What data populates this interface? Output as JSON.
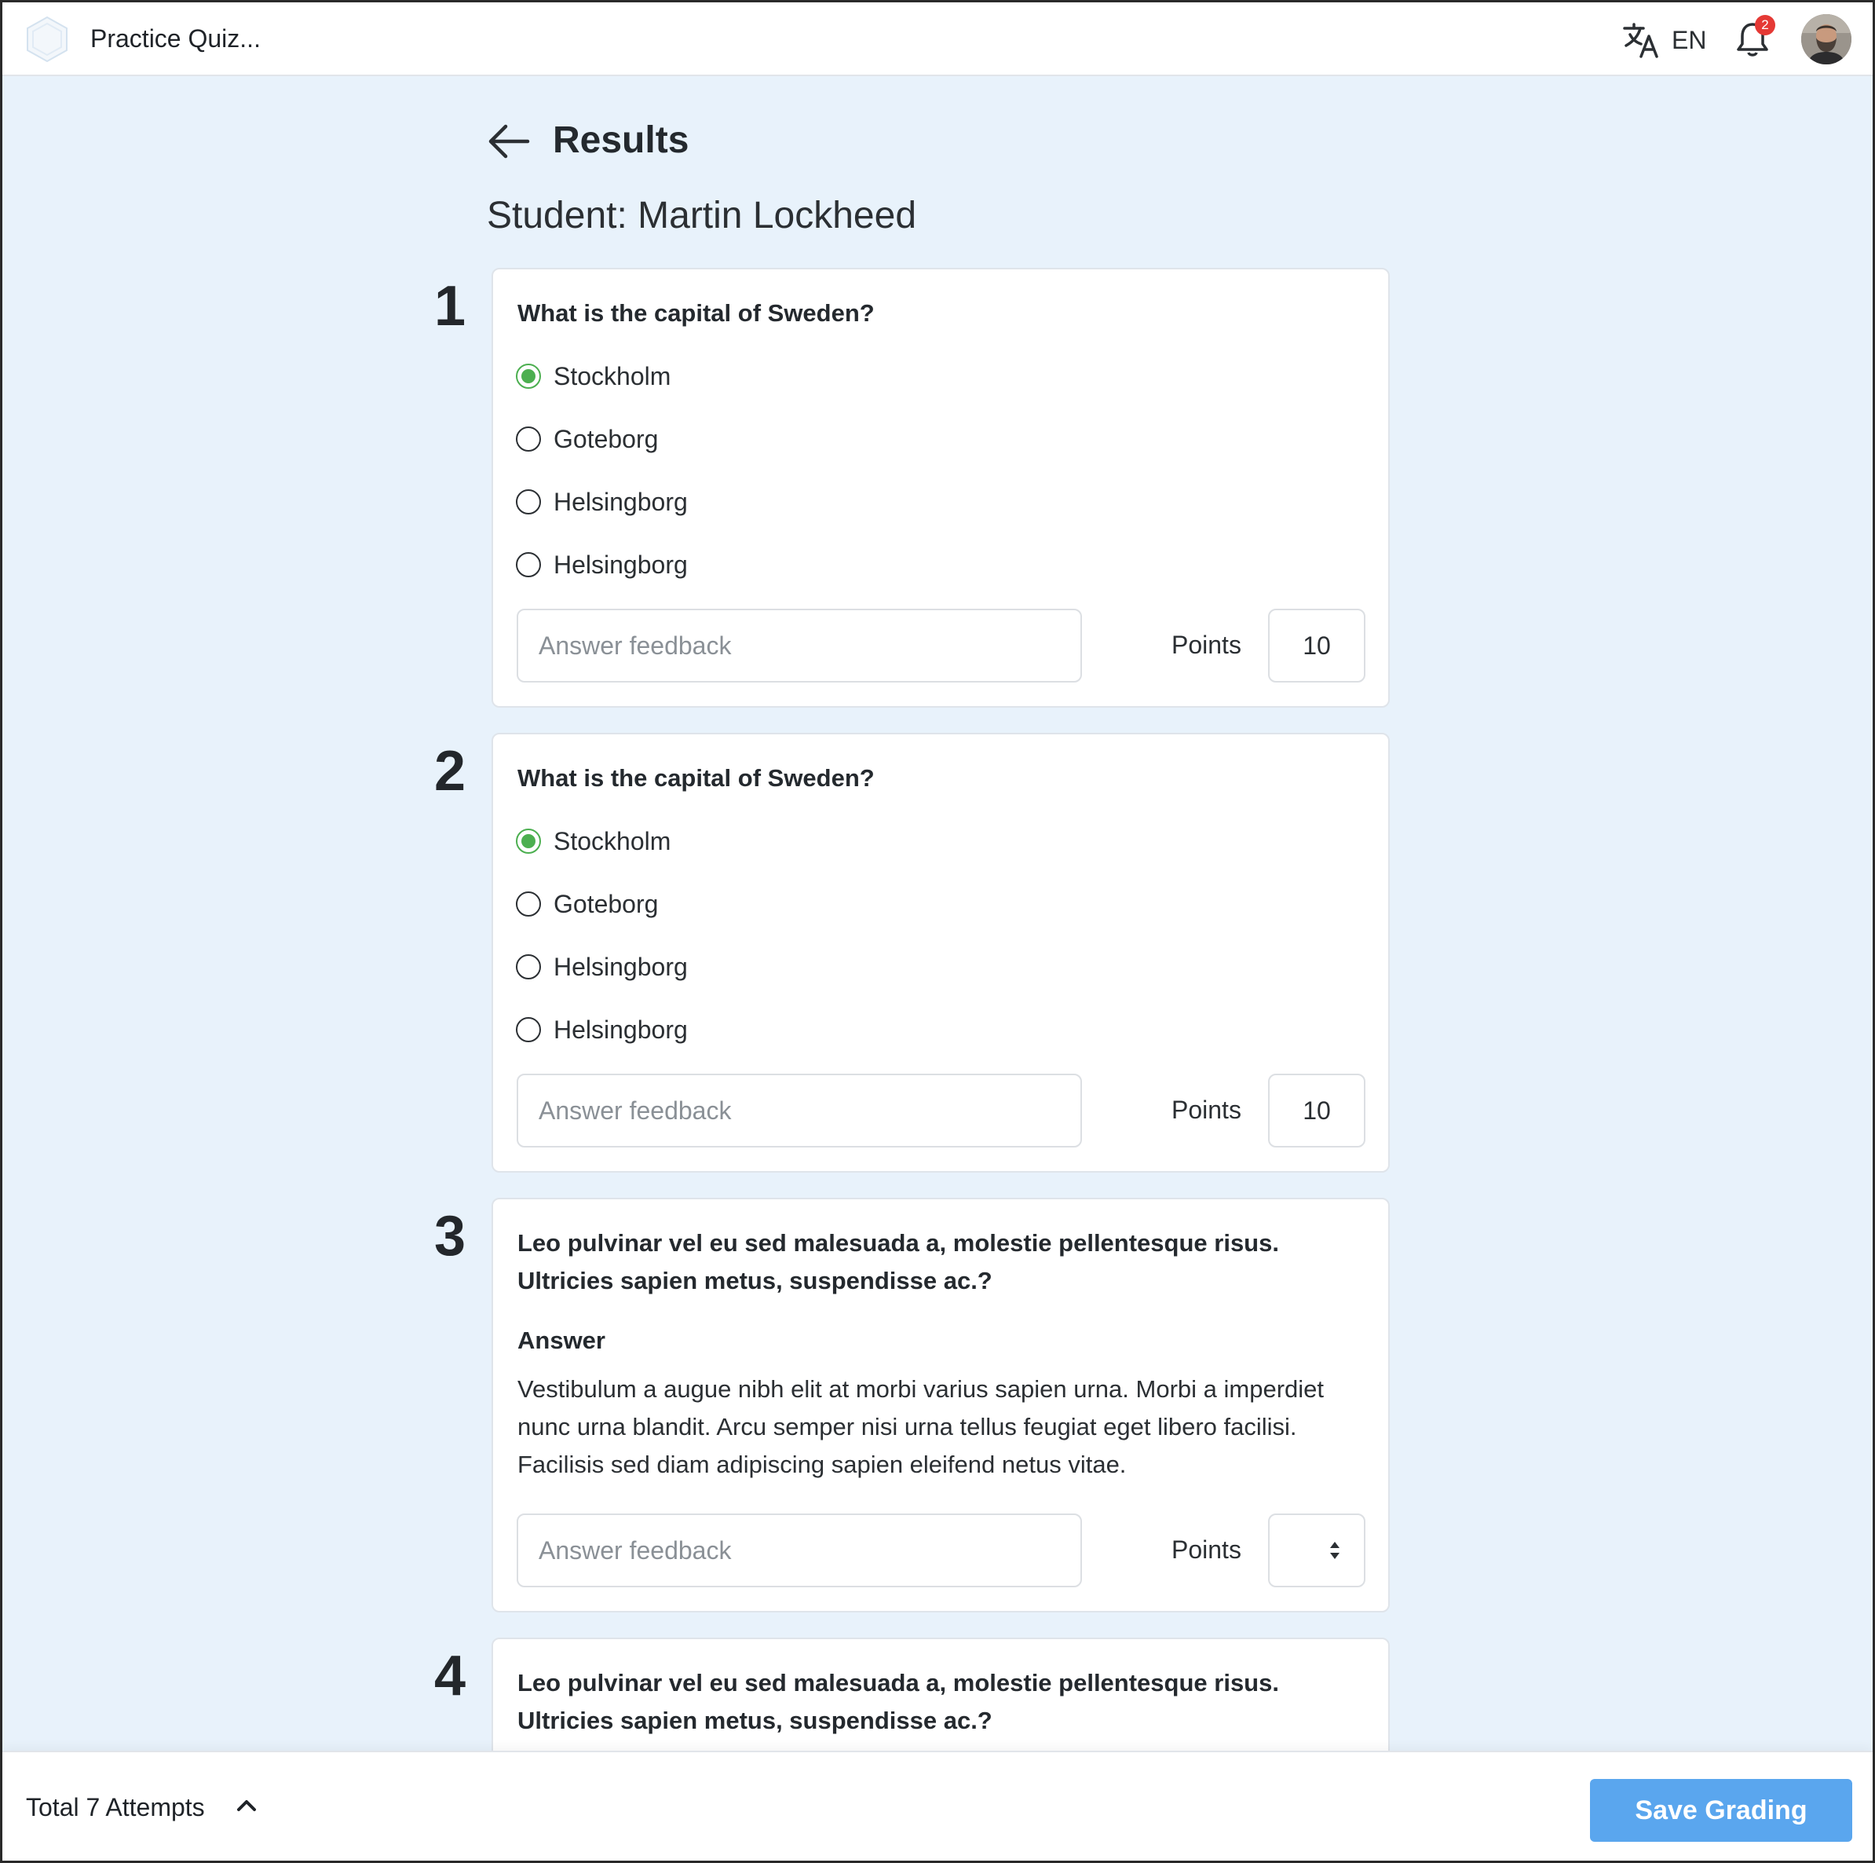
{
  "header": {
    "app_title": "Practice Quiz...",
    "language": "EN",
    "notification_count": "2"
  },
  "page": {
    "title": "Results",
    "student": "Student: Martin Lockheed"
  },
  "questions": [
    {
      "number": "1",
      "text": "What is the capital of Sweden?",
      "options": [
        {
          "label": "Stockholm",
          "selected": true
        },
        {
          "label": "Goteborg",
          "selected": false
        },
        {
          "label": "Helsingborg",
          "selected": false
        },
        {
          "label": "Helsingborg",
          "selected": false
        }
      ],
      "feedback_placeholder": "Answer feedback",
      "points_label": "Points",
      "points": "10"
    },
    {
      "number": "2",
      "text": "What is the capital of Sweden?",
      "options": [
        {
          "label": "Stockholm",
          "selected": true
        },
        {
          "label": "Goteborg",
          "selected": false
        },
        {
          "label": "Helsingborg",
          "selected": false
        },
        {
          "label": "Helsingborg",
          "selected": false
        }
      ],
      "feedback_placeholder": "Answer feedback",
      "points_label": "Points",
      "points": "10"
    },
    {
      "number": "3",
      "text_line1": "Leo pulvinar vel eu sed malesuada a, molestie pellentesque risus.",
      "text_line2": "Ultricies sapien metus, suspendisse ac.?",
      "answer_heading": "Answer",
      "answer_line1": "Vestibulum a augue nibh elit at morbi varius sapien urna. Morbi a imperdiet",
      "answer_line2": "nunc urna blandit. Arcu semper nisi urna tellus feugiat eget libero facilisi.",
      "answer_line3": "Facilisis sed diam adipiscing sapien eleifend netus vitae.",
      "feedback_placeholder": "Answer feedback",
      "points_label": "Points",
      "points": ""
    },
    {
      "number": "4",
      "text_line1": "Leo pulvinar vel eu sed malesuada a, molestie pellentesque risus.",
      "text_line2": "Ultricies sapien metus, suspendisse ac.?"
    }
  ],
  "footer": {
    "attempts": "Total 7 Attempts",
    "save_label": "Save Grading"
  },
  "colors": {
    "page_bg": "#e8f2fb",
    "selected_radio": "#4caf50",
    "primary_button": "#5aa6ee",
    "badge": "#e53935"
  },
  "icons": [
    "logo-icon",
    "translate-icon",
    "bell-icon",
    "avatar",
    "back-arrow-icon",
    "chevron-up-icon",
    "spinner-icon"
  ]
}
